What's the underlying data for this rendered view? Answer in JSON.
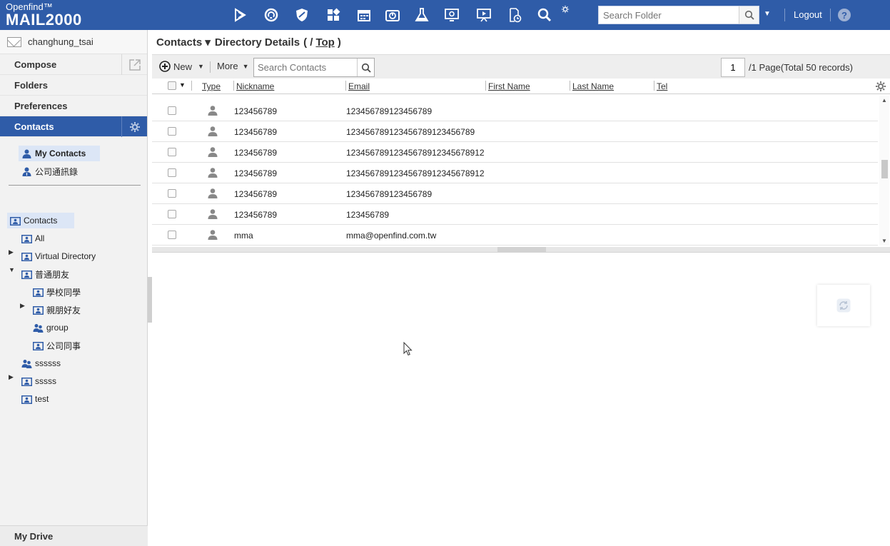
{
  "app": {
    "brand_small": "Openfind™",
    "brand_big": "MAIL2000",
    "accent_color": "#2f5ca8",
    "toolbar_icons": [
      "mail-app-icon",
      "sync-icon",
      "security-shield-icon",
      "modules-icon",
      "calendar-icon",
      "storage-icon",
      "flask-icon",
      "monitor-settings-icon",
      "presentation-icon",
      "document-clock-icon",
      "zoom-icon",
      "settings-small-icon"
    ],
    "search_folder_placeholder": "Search Folder",
    "logout_label": "Logout",
    "help_label": "?"
  },
  "sidebar": {
    "username": "changhung_tsai",
    "nav": [
      {
        "label": "Compose"
      },
      {
        "label": "Folders"
      },
      {
        "label": "Preferences"
      },
      {
        "label": "Contacts"
      }
    ],
    "address_books": [
      {
        "label": "My Contacts"
      },
      {
        "label": "公司通訊錄"
      }
    ],
    "tree": [
      {
        "label": "Contacts"
      },
      {
        "label": "All"
      },
      {
        "label": "Virtual Directory"
      },
      {
        "label": "普通朋友"
      },
      {
        "label": "學校同學"
      },
      {
        "label": "親朋好友"
      },
      {
        "label": "group"
      },
      {
        "label": "公司同事"
      },
      {
        "label": "ssssss"
      },
      {
        "label": "sssss"
      },
      {
        "label": "test"
      }
    ],
    "my_drive": "My Drive"
  },
  "main": {
    "title": {
      "contacts": "Contacts ▾",
      "section": "Directory Details",
      "open_paren": "( /",
      "top_link": "Top",
      "close_paren": ")"
    },
    "toolbar": {
      "new_label": "New",
      "more_label": "More",
      "search_placeholder": "Search Contacts",
      "page_value": "1",
      "page_info": "/1 Page(Total 50 records)"
    },
    "columns": {
      "type": "Type",
      "nickname": "Nickname",
      "email": "Email",
      "first_name": "First Name",
      "last_name": "Last Name",
      "tel": "Tel"
    },
    "rows": [
      {
        "nickname": "123456789",
        "email": "123456789123456789"
      },
      {
        "nickname": "123456789",
        "email": "123456789123456789123456789"
      },
      {
        "nickname": "123456789",
        "email": "1234567891234567891234567891​2"
      },
      {
        "nickname": "123456789",
        "email": "1234567891234567891234567891​2"
      },
      {
        "nickname": "123456789",
        "email": "123456789123456789"
      },
      {
        "nickname": "123456789",
        "email": "123456789"
      },
      {
        "nickname": "mma",
        "email": "mma@openfind.com.tw"
      }
    ]
  }
}
